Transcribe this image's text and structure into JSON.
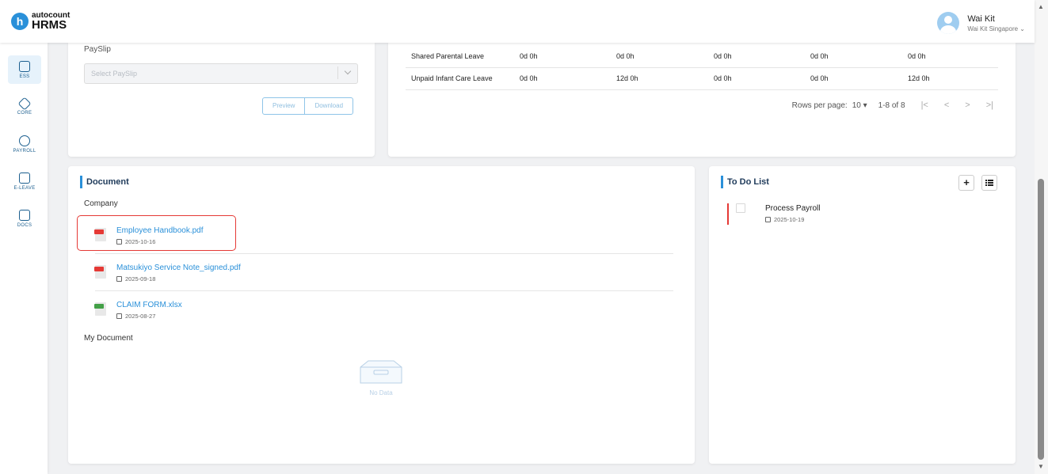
{
  "app": {
    "logo_top": "autocount",
    "logo_bottom": "HRMS",
    "logo_letter": "h"
  },
  "user": {
    "name": "Wai Kit",
    "company": "Wai Kit Singapore ⌄"
  },
  "sidebar": {
    "items": [
      {
        "label": "ESS",
        "active": true
      },
      {
        "label": "CORE"
      },
      {
        "label": "PAYROLL"
      },
      {
        "label": "E-LEAVE"
      },
      {
        "label": "DOCS"
      }
    ]
  },
  "payslip": {
    "label": "PaySlip",
    "select_placeholder": "Select PaySlip",
    "preview_label": "Preview",
    "download_label": "Download"
  },
  "leave_table": {
    "rows": [
      {
        "type": "Shared Parental Leave",
        "c1": "0d 0h",
        "c2": "0d 0h",
        "c3": "0d 0h",
        "c4": "0d 0h",
        "c5": "0d 0h"
      },
      {
        "type": "Unpaid Infant Care Leave",
        "c1": "0d 0h",
        "c2": "12d 0h",
        "c3": "0d 0h",
        "c4": "0d 0h",
        "c5": "12d 0h"
      }
    ],
    "rows_per_page_label": "Rows per page:",
    "rows_per_page_value": "10 ▾",
    "range": "1-8 of 8",
    "nav_first": "|<",
    "nav_prev": "<",
    "nav_next": ">",
    "nav_last": ">|"
  },
  "document": {
    "title": "Document",
    "company_label": "Company",
    "files": [
      {
        "name": "Employee Handbook.pdf",
        "date": "2025-10-16",
        "kind": "pdf"
      },
      {
        "name": "Matsukiyo Service Note_signed.pdf",
        "date": "2025-09-18",
        "kind": "pdf"
      },
      {
        "name": "CLAIM FORM.xlsx",
        "date": "2025-08-27",
        "kind": "xlsx"
      }
    ],
    "my_document_label": "My Document",
    "empty_text": "No Data"
  },
  "todo": {
    "title": "To Do List",
    "add_label": "+",
    "items": [
      {
        "title": "Process Payroll",
        "date": "2025-10-19"
      }
    ]
  },
  "colors": {
    "accent": "#2a90d9",
    "pdf": "#e53935",
    "xlsx": "#43a047",
    "highlight": "#e53935"
  }
}
